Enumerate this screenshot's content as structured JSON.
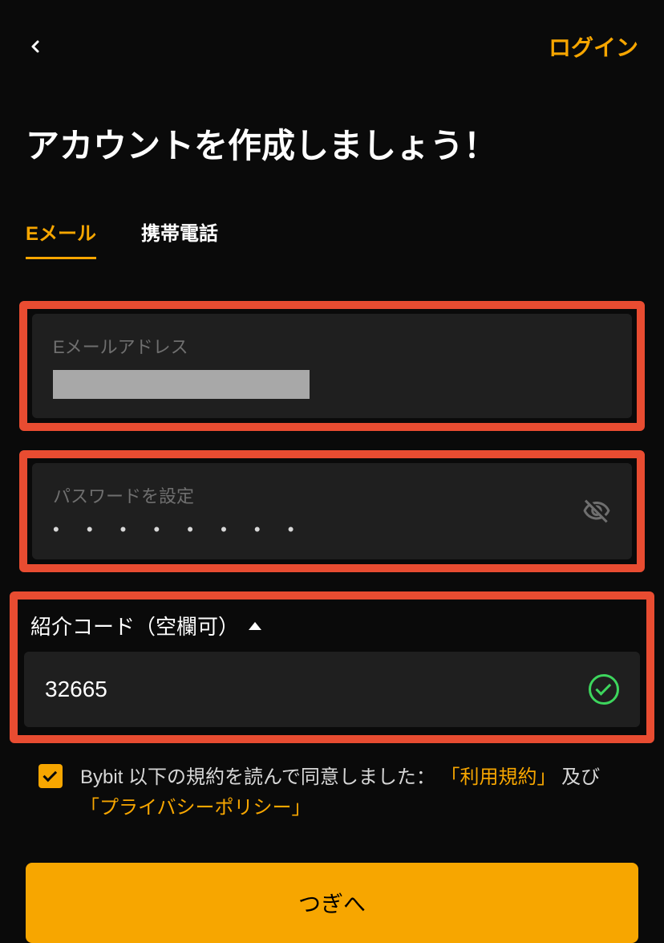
{
  "header": {
    "login_link": "ログイン"
  },
  "page_title": "アカウントを作成しましょう！",
  "tabs": {
    "email": "Eメール",
    "phone": "携帯電話"
  },
  "form": {
    "email": {
      "label": "Eメールアドレス",
      "value": ""
    },
    "password": {
      "label": "パスワードを設定",
      "masked": "• • • • • • • •"
    },
    "referral": {
      "label": "紹介コード（空欄可）",
      "value": "32665"
    }
  },
  "agreement": {
    "prefix": "Bybit 以下の規約を読んで同意しました：",
    "terms_link": "「利用規約」",
    "connector": " 及び ",
    "privacy_link": "「プライバシーポリシー」"
  },
  "next_button": "つぎへ"
}
